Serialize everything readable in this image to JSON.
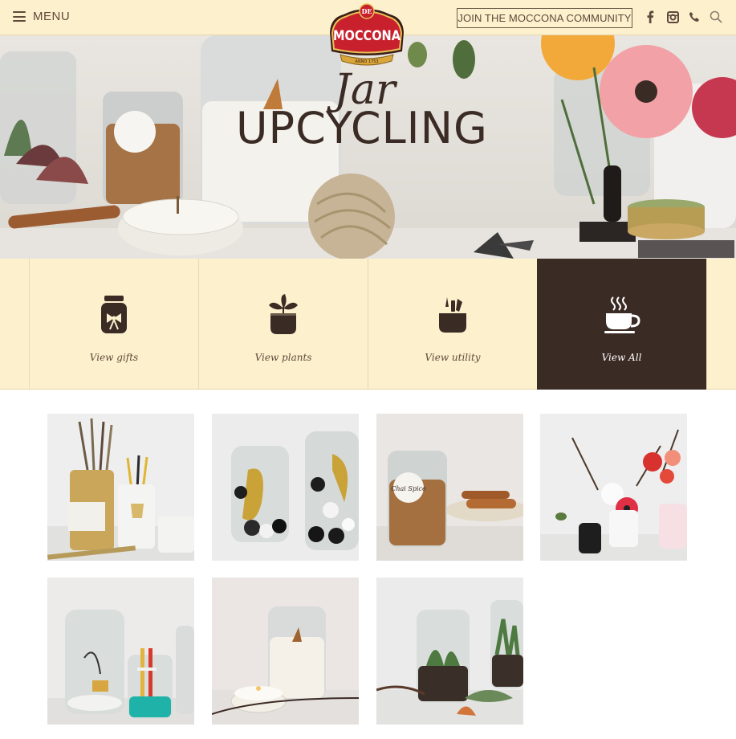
{
  "header": {
    "menu_label": "MENU",
    "brand": "MOCCONA",
    "logo_small_text": "ANNO 1753",
    "logo_badge": "DE",
    "community_button": "JOIN THE MOCCONA COMMUNITY",
    "social_icons": [
      "facebook-icon",
      "instagram-icon",
      "phone-icon",
      "search-icon"
    ]
  },
  "hero": {
    "script_word": "Jar",
    "title": "UPCYCLING"
  },
  "categories": [
    {
      "label": "View gifts",
      "icon": "gift-jar-icon"
    },
    {
      "label": "View plants",
      "icon": "plant-pot-icon"
    },
    {
      "label": "View utility",
      "icon": "utility-pot-icon"
    },
    {
      "label": "View All",
      "icon": "coffee-cup-icon",
      "active": true
    }
  ],
  "gallery": {
    "label_tag": "Chai Spice",
    "items": [
      "pencil-jar-project",
      "pompom-jar-project",
      "chai-spice-jar-project",
      "flower-vase-project",
      "terrarium-sand-project",
      "candle-jar-project",
      "succulent-jar-project"
    ]
  },
  "colors": {
    "header_bg": "#fdf0cc",
    "dark_brown": "#3b2b25",
    "logo_red": "#c8202d",
    "logo_gold": "#d9a63a"
  }
}
